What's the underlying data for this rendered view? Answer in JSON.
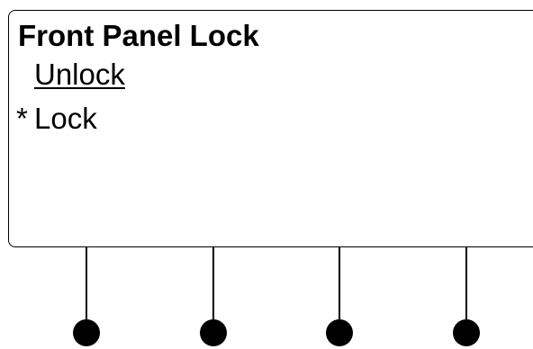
{
  "screen": {
    "title": "Front Panel Lock",
    "items": [
      {
        "marker": "",
        "label": "Unlock",
        "highlighted": true
      },
      {
        "marker": "*",
        "label": "Lock",
        "highlighted": false
      }
    ]
  },
  "softkeys": [
    {
      "icon": "softkey-knob"
    },
    {
      "icon": "softkey-knob"
    },
    {
      "icon": "softkey-knob"
    },
    {
      "icon": "softkey-knob"
    }
  ]
}
